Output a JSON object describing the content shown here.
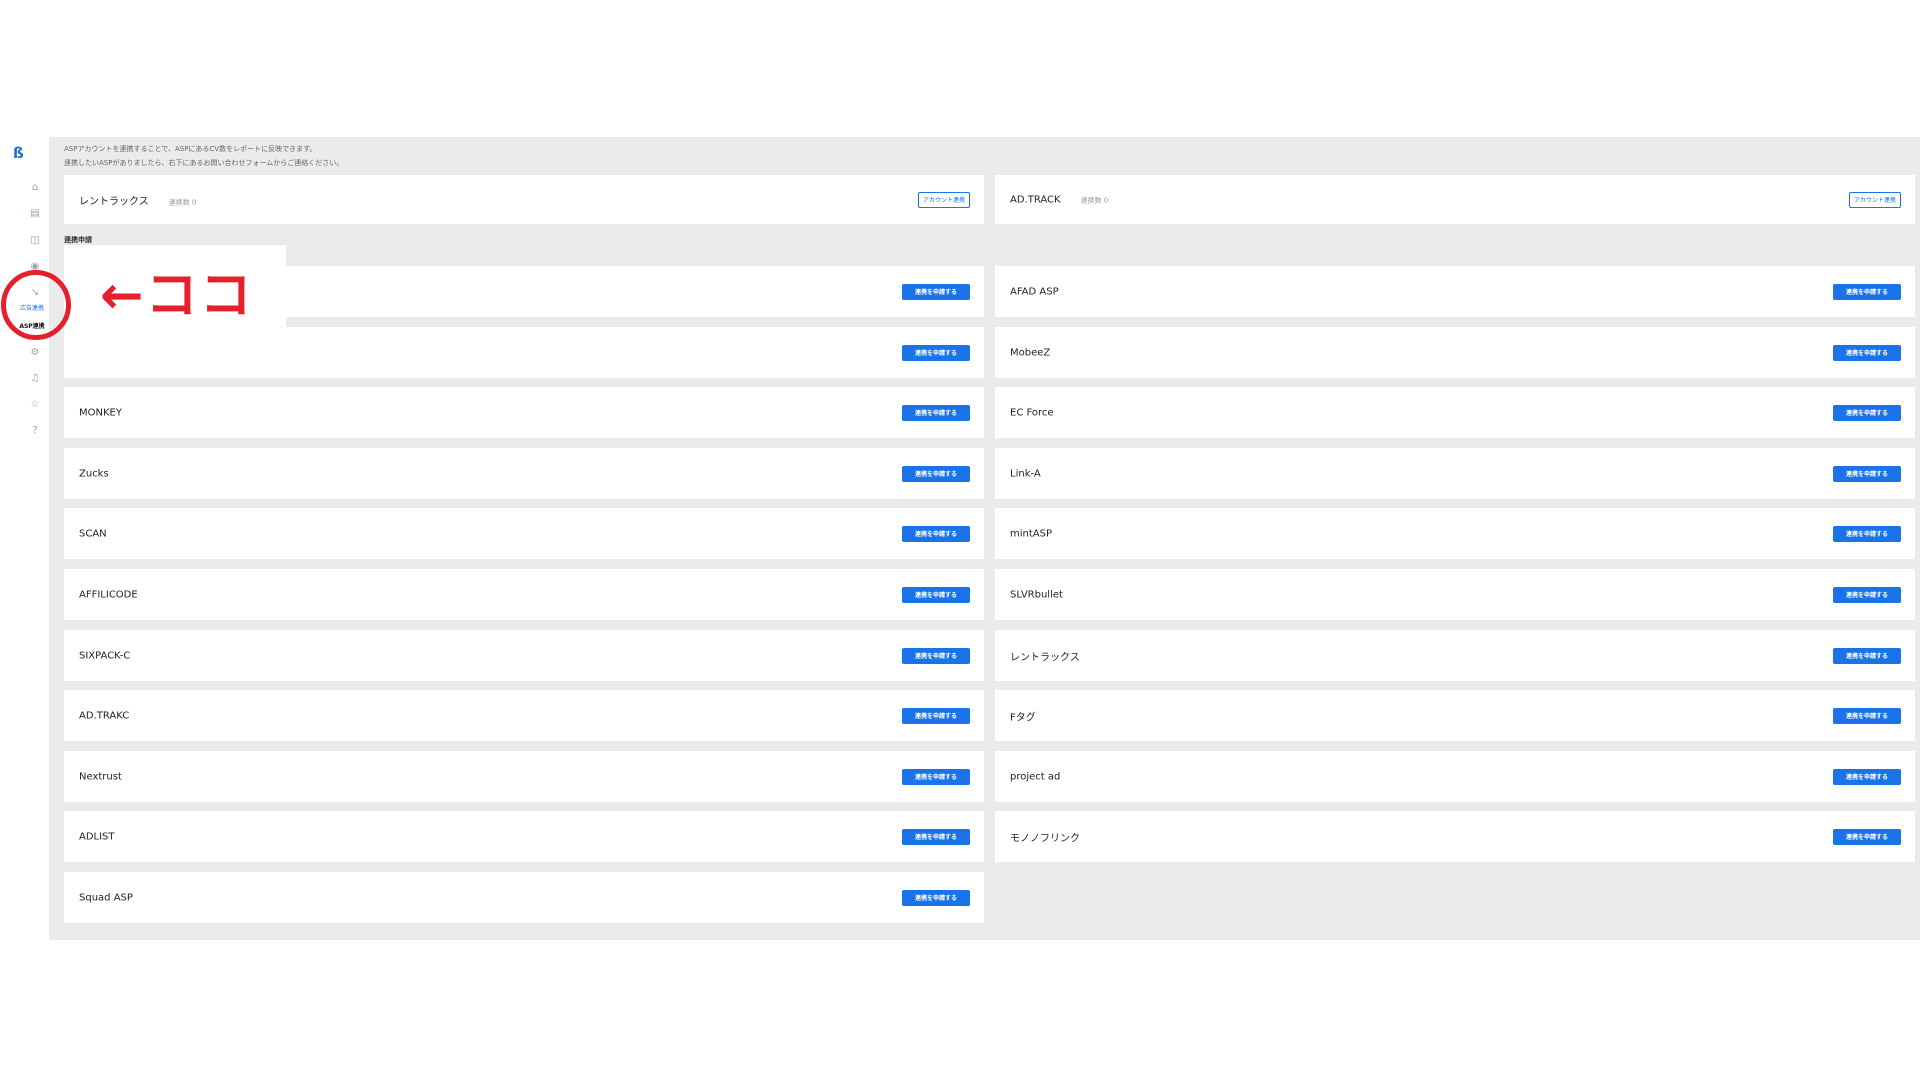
{
  "sidebar": {
    "logo": "ß",
    "icons": [
      "home-icon",
      "document-icon",
      "bag-icon",
      "eye-icon",
      "link-icon",
      "settings-icon",
      "bell-icon",
      "star-icon",
      "help-icon"
    ],
    "active_label": "広告連携",
    "sub_label": "ASP連携"
  },
  "info": {
    "line1": "ASPアカウントを連携することで、ASPにあるCV数をレポートに反映できます。",
    "line2": "連携したいASPがありましたら、右下にあるお問い合わせフォームからご連絡ください。"
  },
  "connected": [
    {
      "name": "レントラックス",
      "count": "連携数 0",
      "button": "アカウント連携"
    },
    {
      "name": "AD.TRACK",
      "count": "連携数 0",
      "button": "アカウント連携"
    }
  ],
  "request_section": {
    "label": "連携申請",
    "sub": "連"
  },
  "request_button_label": "連携を申請する",
  "left_items": [
    "",
    "",
    "MONKEY",
    "Zucks",
    "SCAN",
    "AFFILICODE",
    "SIXPACK-C",
    "AD.TRAKC",
    "Nextrust",
    "ADLIST",
    "Squad ASP"
  ],
  "right_items": [
    "AFAD ASP",
    "MobeeZ",
    "EC Force",
    "Link-A",
    "mintASP",
    "SLVRbullet",
    "レントラックス",
    "Fタグ",
    "project ad",
    "モノノフリンク"
  ],
  "annotation": {
    "text": "←ココ",
    "color": "#e5202b"
  },
  "colors": {
    "accent": "#1a73e8",
    "background": "#ebebeb"
  }
}
